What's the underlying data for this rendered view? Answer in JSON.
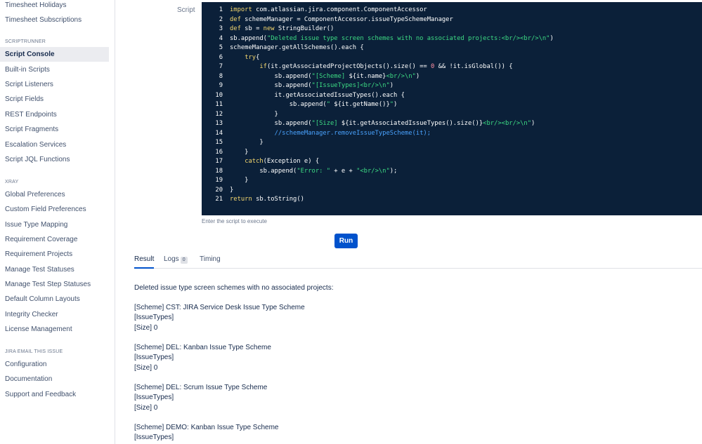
{
  "sidebar": {
    "top_items": [
      "Timesheet Holidays",
      "Timesheet Subscriptions"
    ],
    "sections": [
      {
        "heading": "SCRIPTRUNNER",
        "items": [
          "Script Console",
          "Built-in Scripts",
          "Script Listeners",
          "Script Fields",
          "REST Endpoints",
          "Script Fragments",
          "Escalation Services",
          "Script JQL Functions"
        ]
      },
      {
        "heading": "XRAY",
        "items": [
          "Global Preferences",
          "Custom Field Preferences",
          "Issue Type Mapping",
          "Requirement Coverage",
          "Requirement Projects",
          "Manage Test Statuses",
          "Manage Test Step Statuses",
          "Default Column Layouts",
          "Integrity Checker",
          "License Management"
        ]
      },
      {
        "heading": "JIRA EMAIL THIS ISSUE",
        "items": [
          "Configuration",
          "Documentation",
          "Support and Feedback"
        ]
      }
    ],
    "active_item": "Script Console"
  },
  "script_label": "Script",
  "editor": {
    "lines": [
      "import com.atlassian.jira.component.ComponentAccessor",
      "def schemeManager = ComponentAccessor.issueTypeSchemeManager",
      "def sb = new StringBuilder()",
      "sb.append(\"Deleted issue type screen schemes with no associated projects:<br/><br/>\\n\")",
      "schemeManager.getAllSchemes().each {",
      "    try{",
      "        if(it.getAssociatedProjectObjects().size() == 0 && !it.isGlobal()) {",
      "            sb.append(\"[Scheme] ${it.name}<br/>\\n\")",
      "            sb.append(\"[IssueTypes]<br/>\\n\")",
      "            it.getAssociatedIssueTypes().each {",
      "                sb.append(\" ${it.getName()}\")",
      "            }",
      "            sb.append(\"[Size] ${it.getAssociatedIssueTypes().size()}<br/><br/>\\n\")",
      "            //schemeManager.removeIssueTypeScheme(it);",
      "        }",
      "    }",
      "    catch(Exception e) {",
      "        sb.append(\"Error: \" + e + \"<br/>\\n\");",
      "    }",
      "}",
      "return sb.toString()"
    ],
    "helper_text": "Enter the script to execute"
  },
  "run_button": "Run",
  "tabs": {
    "result": "Result",
    "logs": "Logs",
    "logs_count": "0",
    "timing": "Timing"
  },
  "result": {
    "header": "Deleted issue type screen schemes with no associated projects:",
    "blocks": [
      [
        "[Scheme] CST: JIRA Service Desk Issue Type Scheme",
        "[IssueTypes]",
        "[Size] 0"
      ],
      [
        "[Scheme] DEL: Kanban Issue Type Scheme",
        "[IssueTypes]",
        "[Size] 0"
      ],
      [
        "[Scheme] DEL: Scrum Issue Type Scheme",
        "[IssueTypes]",
        "[Size] 0"
      ],
      [
        "[Scheme] DEMO: Kanban Issue Type Scheme",
        "[IssueTypes]"
      ]
    ]
  },
  "colors": {
    "editor_bg": "#0b2039",
    "keyword": "#f5d76e",
    "string": "#3ddc84",
    "number": "#ff8fa3",
    "comment": "#4aa3ff",
    "primary": "#0052cc"
  }
}
